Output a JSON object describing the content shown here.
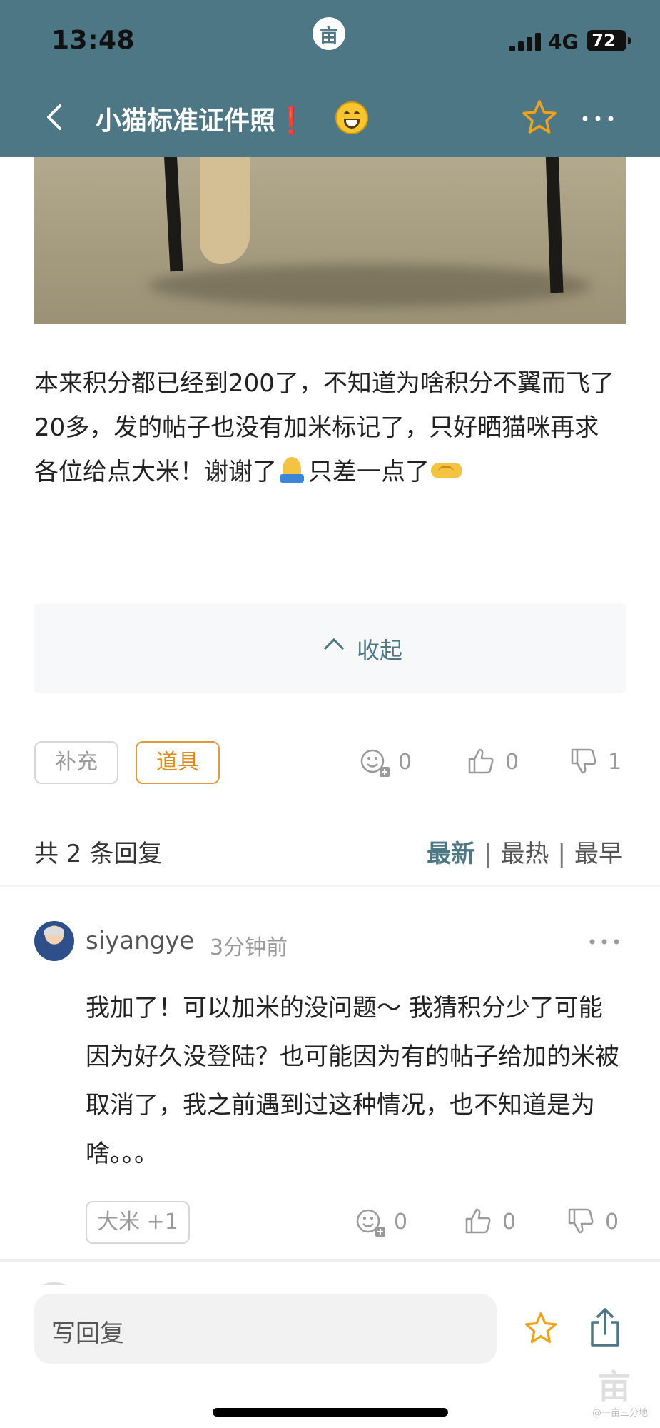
{
  "status_bar": {
    "time": "13:48",
    "app_badge": "亩",
    "network": "4G",
    "battery": "72"
  },
  "nav": {
    "title": "小猫标准证件照",
    "title_mark": "❗",
    "title_emoji": "grinning-face-emoji",
    "icons": [
      "back-chevron-icon",
      "star-outline-icon",
      "more-dots-icon"
    ],
    "bar_color": "#4d7785"
  },
  "post": {
    "text_before_pray": "本来积分都已经到200了，不知道为啥积分不翼而飞了20多，发的帖子也没有加米标记了，只好晒猫咪再求各位给点大米！谢谢了",
    "text_after_pray": "只差一点了",
    "collapse_label": "收起",
    "supplement_label": "补充",
    "props_label": "道具",
    "reactions": {
      "emoji_count": "0",
      "like_count": "0",
      "dislike_count": "1"
    }
  },
  "replies": {
    "count_label": "共 2 条回复",
    "sort": {
      "newest": "最新",
      "separator": "|",
      "hottest": "最热",
      "earliest": "最早"
    }
  },
  "comments": [
    {
      "username": "siyangye",
      "time": "3分钟前",
      "text": "我加了！可以加米的没问题～ 我猜积分少了可能因为好久没登陆？也可能因为有的帖子给加的米被取消了，我之前遇到过这种情况，也不知道是为啥。。。",
      "rice_label": "大米 +1",
      "reactions": {
        "emoji_count": "0",
        "like_count": "0",
        "dislike_count": "0"
      }
    }
  ],
  "bottom_bar": {
    "reply_placeholder": "写回复",
    "watermark": "亩",
    "watermark_sub": "@一亩三分地"
  },
  "colors": {
    "accent": "#4d7785",
    "orange": "#e08a1a",
    "star": "#f0a21a"
  }
}
